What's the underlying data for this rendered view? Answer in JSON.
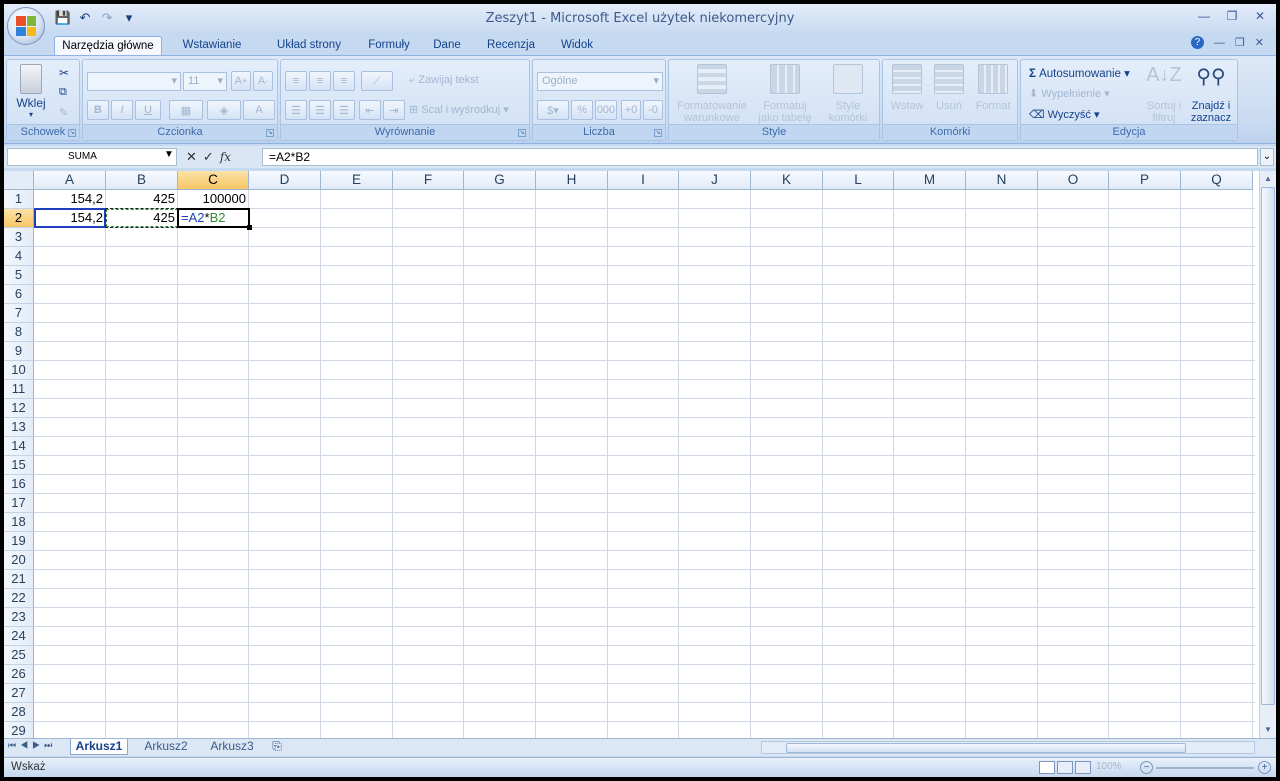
{
  "app": {
    "title": "Zeszyt1 - Microsoft Excel użytek niekomercyjny",
    "quick_access": [
      "save-icon",
      "undo-icon",
      "redo-icon",
      "customize-icon"
    ]
  },
  "tabs": [
    "Narzędzia główne",
    "Wstawianie",
    "Układ strony",
    "Formuły",
    "Dane",
    "Recenzja",
    "Widok"
  ],
  "ribbon": {
    "clipboard": {
      "label": "Schowek",
      "paste": "Wklej"
    },
    "font": {
      "label": "Czcionka",
      "size": "11",
      "font_name": ""
    },
    "alignment": {
      "label": "Wyrównanie",
      "wrap": "Zawijaj tekst",
      "merge": "Scal i wyśrodkuj"
    },
    "number": {
      "label": "Liczba",
      "format": "Ogólne",
      "percent": "%",
      "thousands": "000"
    },
    "styles": {
      "label": "Style",
      "cond_l1": "Formatowanie",
      "cond_l2": "warunkowe",
      "table_l1": "Formatuj",
      "table_l2": "jako tabelę",
      "cell_l1": "Style",
      "cell_l2": "komórki"
    },
    "cells": {
      "label": "Komórki",
      "insert": "Wstaw",
      "delete": "Usuń",
      "format": "Format"
    },
    "editing": {
      "label": "Edycja",
      "autosum": "Autosumowanie",
      "fill": "Wypełnienie",
      "clear": "Wyczyść",
      "sort_l1": "Sortuj i",
      "sort_l2": "filtruj",
      "find_l1": "Znajdź i",
      "find_l2": "zaznacz"
    }
  },
  "formula_bar": {
    "name_box": "SUMA",
    "fx": "fx",
    "formula": "=A2*B2"
  },
  "columns": [
    "A",
    "B",
    "C",
    "D",
    "E",
    "F",
    "G",
    "H",
    "I",
    "J",
    "K",
    "L",
    "M",
    "N",
    "O",
    "P",
    "Q"
  ],
  "rows": [
    "1",
    "2",
    "3",
    "4",
    "5",
    "6",
    "7",
    "8",
    "9",
    "10",
    "11",
    "12",
    "13",
    "14",
    "15",
    "16",
    "17",
    "18",
    "19",
    "20",
    "21",
    "22",
    "23",
    "24",
    "25",
    "26",
    "27",
    "28",
    "29"
  ],
  "cells": {
    "A1": "154,2",
    "B1": "425",
    "C1": "100000",
    "A2": "154,2",
    "B2": "425",
    "C2_eq": "=A2",
    "C2_op": "*",
    "C2_ref": "B2"
  },
  "sheets": [
    "Arkusz1",
    "Arkusz2",
    "Arkusz3"
  ],
  "status": {
    "mode": "Wskaż",
    "zoom": "100%"
  },
  "colors": {
    "ref_a": "#0000ff",
    "ref_b": "#008000"
  }
}
